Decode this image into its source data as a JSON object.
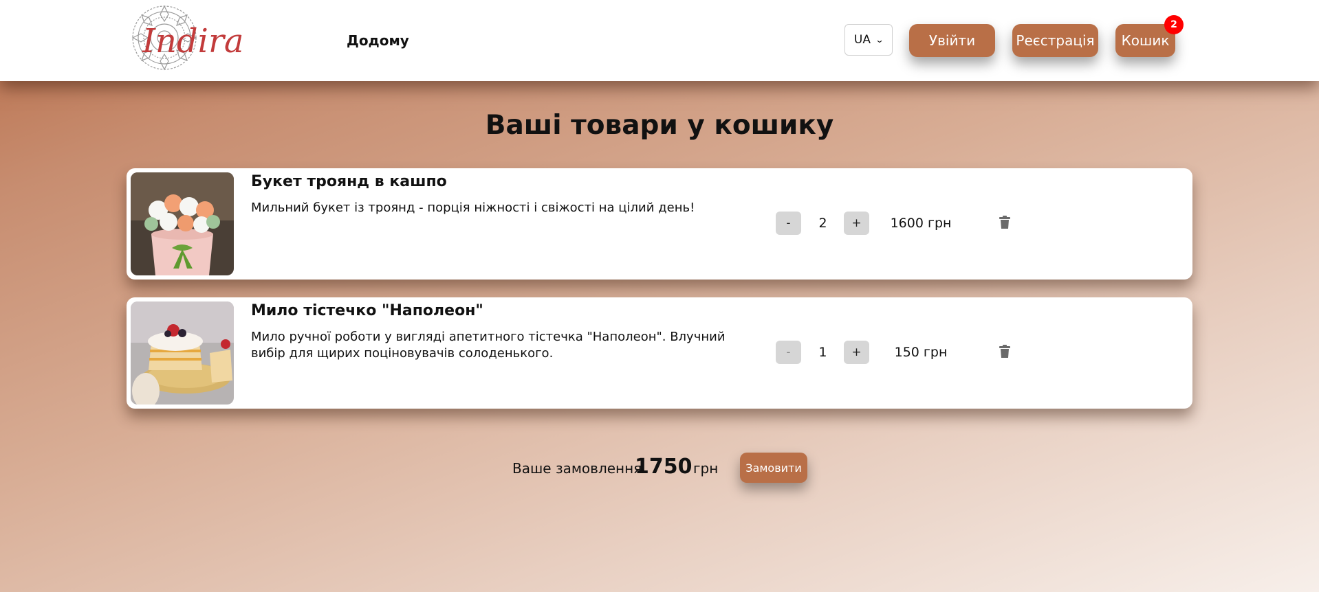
{
  "header": {
    "logo_text": "Indira",
    "nav_home": "Додому",
    "language": "UA",
    "login": "Увійти",
    "register": "Реєстрація",
    "cart": "Кошик",
    "cart_count": "2"
  },
  "page": {
    "title": "Ваші товари у кошику"
  },
  "cart_items": [
    {
      "name": "Букет троянд в кашпо",
      "description": "Мильний букет із троянд - порція ніжності і свіжості на цілий день!",
      "minus": "-",
      "quantity": "2",
      "plus": "+",
      "price": "1600 грн"
    },
    {
      "name": "Мило тістечко \"Наполеон\"",
      "description": "Мило ручної роботи у вигляді апетитного тістечка \"Наполеон\". Влучний вибір для щирих поціновувачів солоденького.",
      "minus": "-",
      "quantity": "1",
      "plus": "+",
      "price": "150 грн"
    }
  ],
  "summary": {
    "label": "Ваше замовлення",
    "total": "1750",
    "currency": "грн",
    "order_button": "Замовити"
  },
  "colors": {
    "accent": "#b96f47",
    "badge": "#ff0000",
    "logo": "#c23b3b"
  }
}
